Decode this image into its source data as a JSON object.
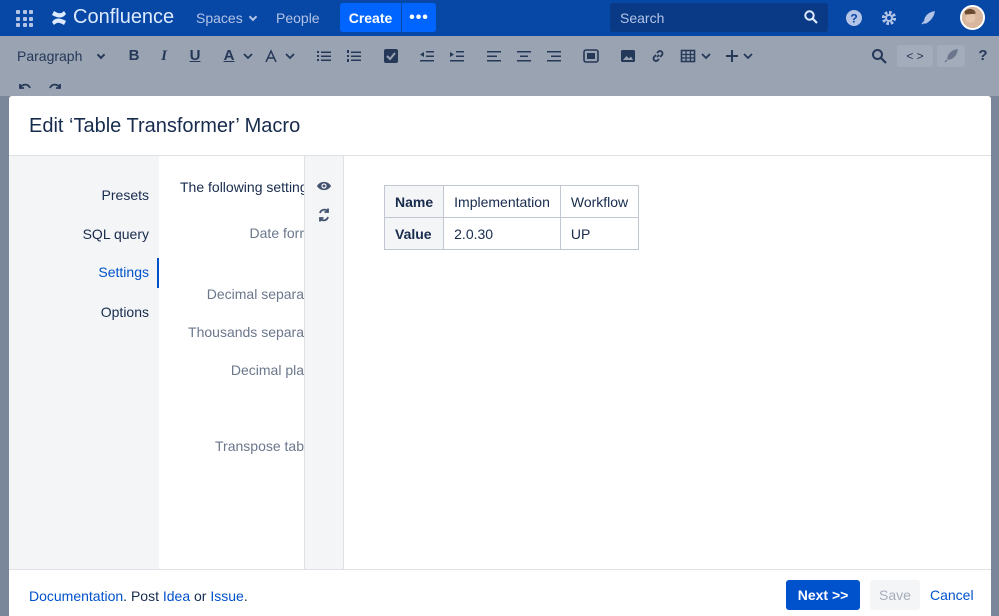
{
  "nav": {
    "logo": "Confluence",
    "spaces": "Spaces",
    "people": "People",
    "create": "Create",
    "more": "•••",
    "search_placeholder": "Search"
  },
  "toolbar": {
    "paragraph": "Paragraph",
    "bold": "B",
    "italic": "I",
    "underline": "U",
    "text_color": "A",
    "code": "< >",
    "help": "?"
  },
  "modal": {
    "title": "Edit ‘Table Transformer’ Macro",
    "sidebar": [
      {
        "label": "Presets"
      },
      {
        "label": "SQL query"
      },
      {
        "label": "Settings"
      },
      {
        "label": "Options"
      }
    ],
    "settings_heading": "The following setting",
    "settings_labels": [
      {
        "label": "Date forr"
      },
      {
        "label": "Decimal separa"
      },
      {
        "label": "Thousands separa"
      },
      {
        "label": "Decimal pla"
      },
      {
        "label": "Transpose tab"
      }
    ],
    "preview_table": {
      "rows": [
        [
          "Name",
          "Implementation",
          "Workflow"
        ],
        [
          "Value",
          "2.0.30",
          "UP"
        ]
      ]
    },
    "footer": {
      "documentation": "Documentation",
      "post": ". Post ",
      "idea": "Idea",
      "or": " or ",
      "issue": "Issue",
      "period": ".",
      "next": "Next >>",
      "save": "Save",
      "cancel": "Cancel"
    }
  }
}
